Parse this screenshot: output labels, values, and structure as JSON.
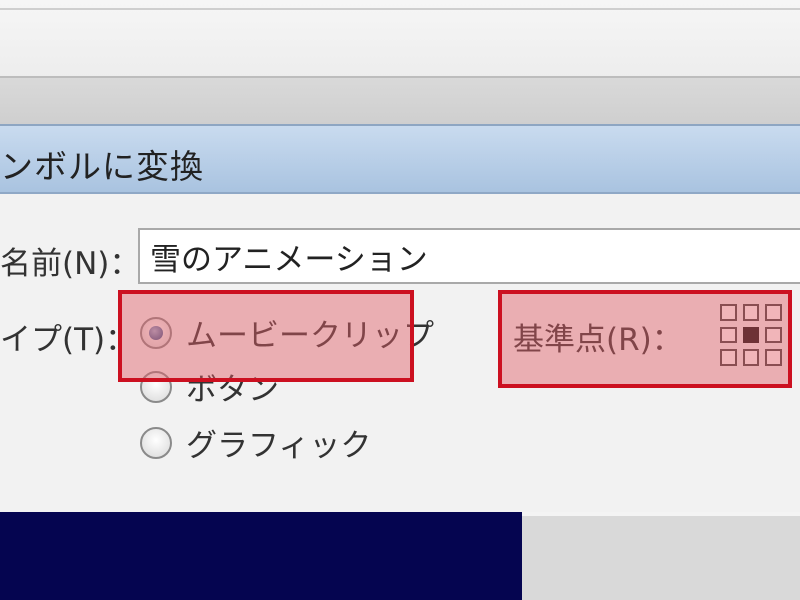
{
  "dialog": {
    "title": "ンボルに変換",
    "name_label": "名前(N)：",
    "name_value": "雪のアニメーション",
    "type_label": "イプ(T)：",
    "types": [
      {
        "label": "ムービークリップ",
        "selected": true
      },
      {
        "label": "ボタン",
        "selected": false
      },
      {
        "label": "グラフィック",
        "selected": false
      }
    ],
    "registration_label": "基準点(R)：",
    "registration_selected": "center"
  },
  "colors": {
    "highlight_border": "#cc1020",
    "highlight_fill": "#e15a64",
    "titlebar": "#b6cde6",
    "stage_bg": "#050550"
  }
}
